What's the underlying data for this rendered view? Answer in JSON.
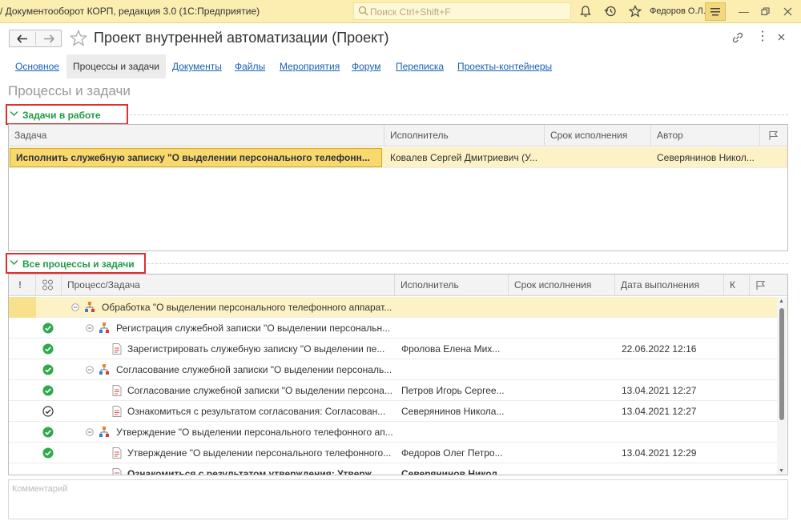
{
  "titlebar": {
    "app_title": "/ Документооборот КОРП, редакция 3.0  (1С:Предприятие)",
    "search_placeholder": "Поиск Ctrl+Shift+F",
    "user": "Федоров О.Л."
  },
  "header": {
    "doc_title": "Проект внутренней автоматизации (Проект)"
  },
  "tabs": [
    {
      "label": "Основное",
      "active": false
    },
    {
      "label": "Процессы и задачи",
      "active": true
    },
    {
      "label": "Документы",
      "active": false
    },
    {
      "label": "Файлы",
      "active": false
    },
    {
      "label": "Мероприятия",
      "active": false
    },
    {
      "label": "Форум",
      "active": false
    },
    {
      "label": "Переписка",
      "active": false
    },
    {
      "label": "Проекты-контейнеры",
      "active": false
    }
  ],
  "section_title": "Процессы и задачи",
  "tasks_group": {
    "title": "Задачи в работе",
    "columns": [
      "Задача",
      "Исполнитель",
      "Срок исполнения",
      "Автор"
    ],
    "rows": [
      {
        "task": "Исполнить служебную записку \"О выделении персонального телефонн...",
        "executor": "Ковалев Сергей Дмитриевич (У...",
        "deadline": "",
        "author": "Северянинов Никол..."
      }
    ]
  },
  "processes_group": {
    "title": "Все процессы и задачи",
    "columns": [
      "Процесс/Задача",
      "Исполнитель",
      "Срок исполнения",
      "Дата выполнения",
      "К"
    ],
    "rows": [
      {
        "level": 0,
        "kind": "process",
        "status": "",
        "name": "Обработка \"О выделении персонального телефонного аппарат...",
        "executor": "",
        "deadline": "",
        "done": ""
      },
      {
        "level": 1,
        "kind": "process",
        "status": "done",
        "name": "Регистрация служебной записки \"О выделении персональн...",
        "executor": "",
        "deadline": "",
        "done": ""
      },
      {
        "level": 2,
        "kind": "task",
        "status": "done",
        "name": "Зарегистрировать служебную записку \"О выделении пе...",
        "executor": "Фролова Елена Мих...",
        "deadline": "",
        "done": "22.06.2022 12:16"
      },
      {
        "level": 1,
        "kind": "process",
        "status": "done",
        "name": "Согласование служебной записки \"О выделении персональ...",
        "executor": "",
        "deadline": "",
        "done": ""
      },
      {
        "level": 2,
        "kind": "task",
        "status": "done",
        "name": "Согласование служебной записки \"О выделении персона...",
        "executor": "Петров Игорь Сергее...",
        "deadline": "",
        "done": "13.04.2021 12:27"
      },
      {
        "level": 2,
        "kind": "task",
        "status": "checked",
        "name": "Ознакомиться с результатом согласования: Согласован...",
        "executor": "Северянинов Никола...",
        "deadline": "",
        "done": "13.04.2021 12:27"
      },
      {
        "level": 1,
        "kind": "process",
        "status": "done",
        "name": "Утверждение \"О выделении персонального телефонного ап...",
        "executor": "",
        "deadline": "",
        "done": ""
      },
      {
        "level": 2,
        "kind": "task",
        "status": "done",
        "name": "Утверждение \"О выделении персонального телефонного...",
        "executor": "Федоров Олег Петро...",
        "deadline": "",
        "done": "13.04.2021 12:29"
      },
      {
        "level": 2,
        "kind": "task",
        "status": "",
        "name": "Ознакомиться с результатом утверждения: Утверж...",
        "executor": "Северянинов Никола...",
        "deadline": "",
        "done": "",
        "bold": true
      }
    ]
  },
  "comment_placeholder": "Комментарий"
}
